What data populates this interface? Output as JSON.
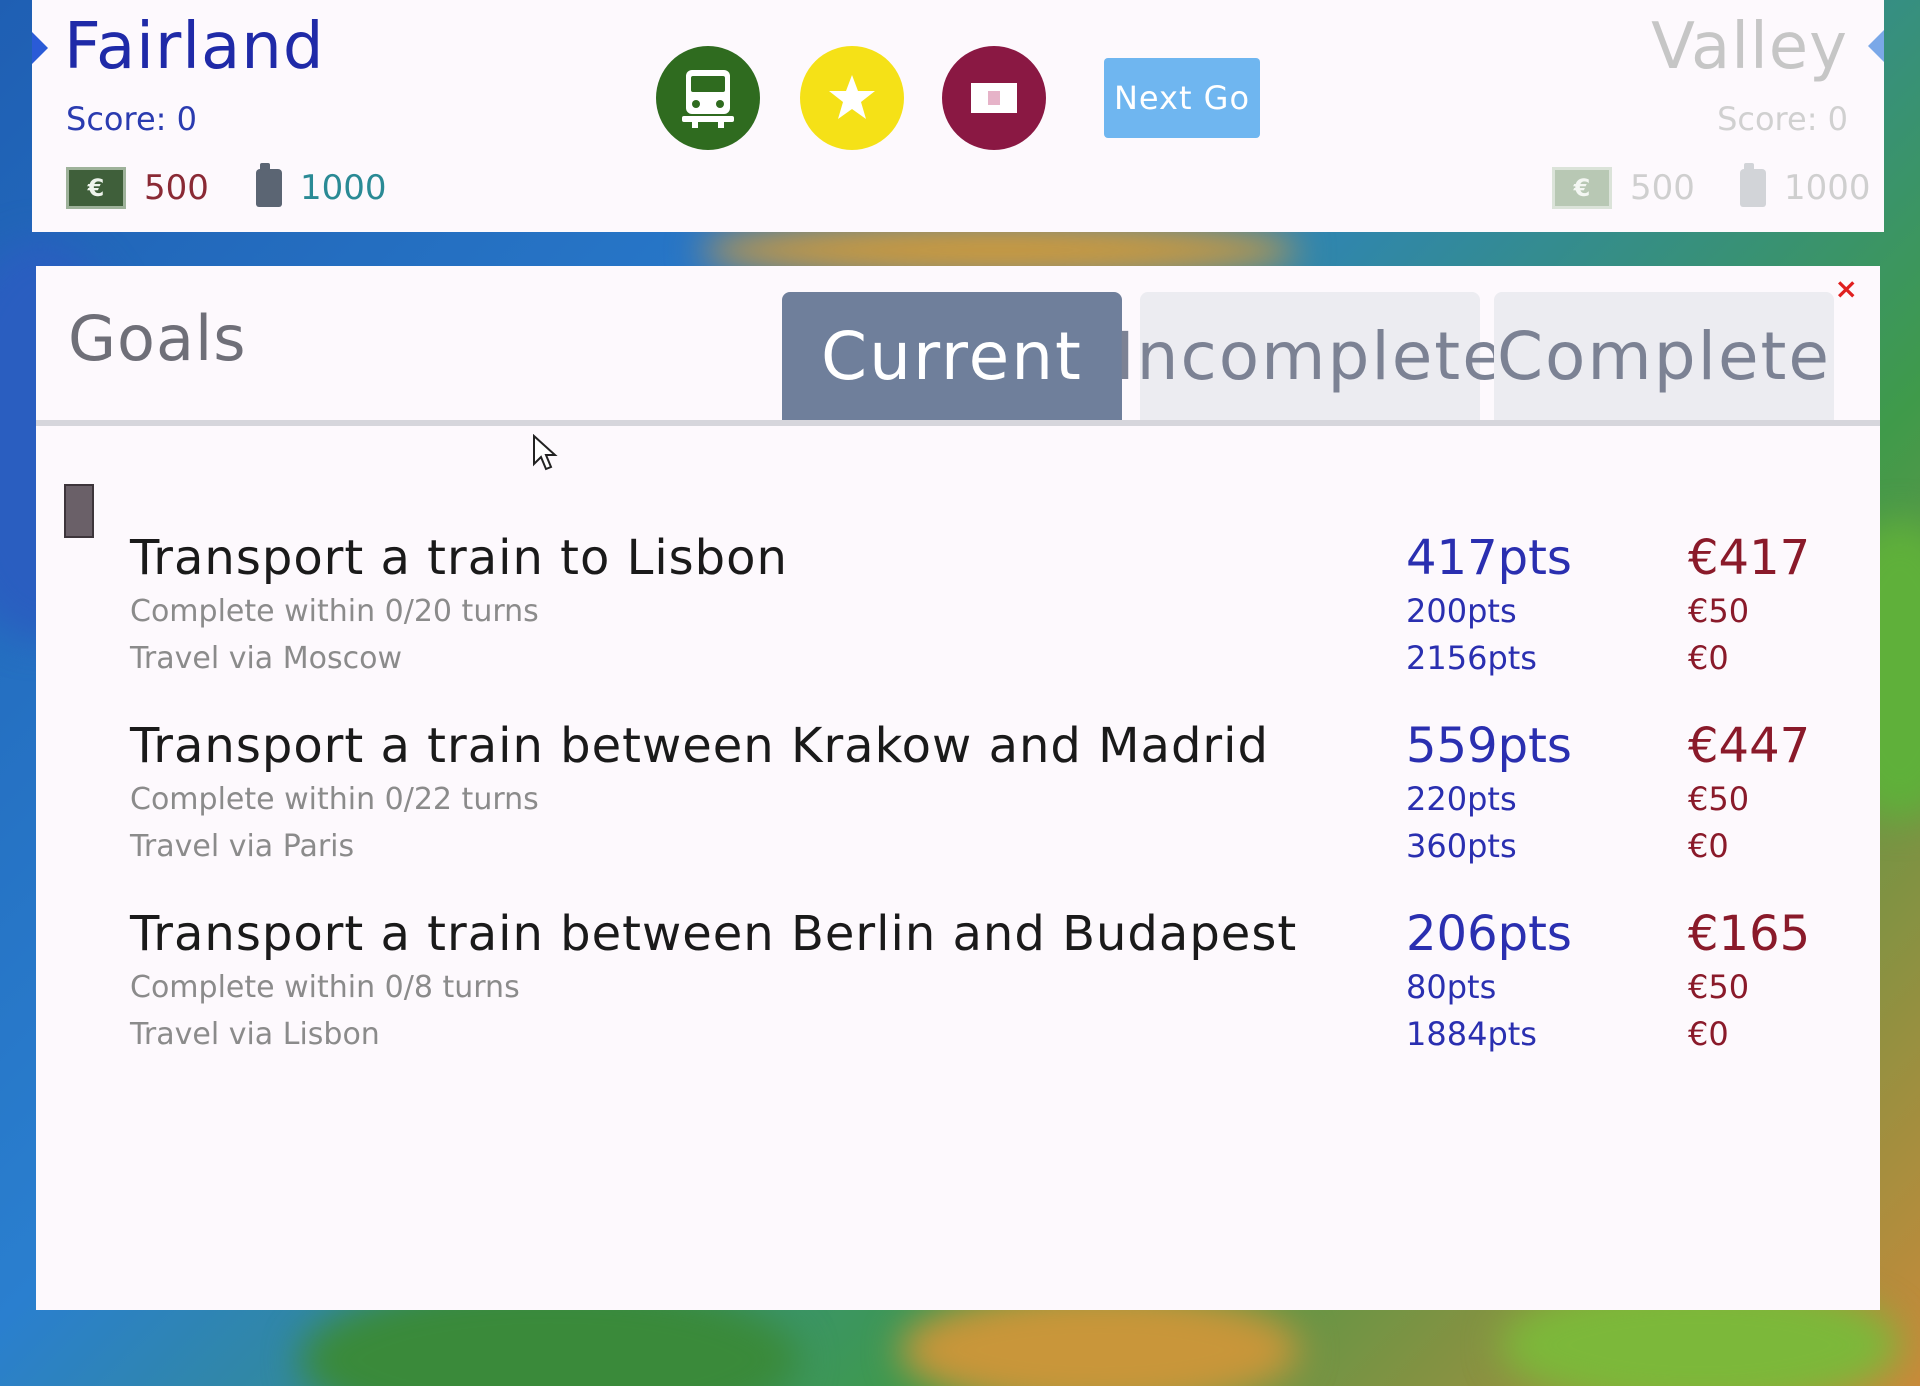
{
  "players": {
    "left": {
      "name": "Fairland",
      "score": "Score: 0",
      "money": "500",
      "fuel": "1000"
    },
    "right": {
      "name": "Valley",
      "score": "Score: 0",
      "money": "500",
      "fuel": "1000"
    }
  },
  "toolbar": {
    "train_icon": "train-icon",
    "star_icon": "star-icon",
    "ticket_icon": "ticket-icon",
    "next_label": "Next Go"
  },
  "currency_symbol": "€",
  "goals_panel": {
    "title": "Goals",
    "close_label": "×",
    "tabs": [
      {
        "label": "Current",
        "active": true
      },
      {
        "label": "Incomplete",
        "active": false
      },
      {
        "label": "Complete",
        "active": false
      }
    ],
    "goals": [
      {
        "title": "Transport a train to Lisbon",
        "points": "417pts",
        "money": "€417",
        "sub": [
          {
            "text": "Complete within 0/20 turns",
            "points": "200pts",
            "money": "€50"
          },
          {
            "text": "Travel via Moscow",
            "points": "2156pts",
            "money": "€0"
          }
        ]
      },
      {
        "title": "Transport a train between Krakow and Madrid",
        "points": "559pts",
        "money": "€447",
        "sub": [
          {
            "text": "Complete within 0/22 turns",
            "points": "220pts",
            "money": "€50"
          },
          {
            "text": "Travel via Paris",
            "points": "360pts",
            "money": "€0"
          }
        ]
      },
      {
        "title": "Transport a train between Berlin and Budapest",
        "points": "206pts",
        "money": "€165",
        "sub": [
          {
            "text": "Complete within 0/8 turns",
            "points": "80pts",
            "money": "€50"
          },
          {
            "text": "Travel via Lisbon",
            "points": "1884pts",
            "money": "€0"
          }
        ]
      }
    ]
  }
}
